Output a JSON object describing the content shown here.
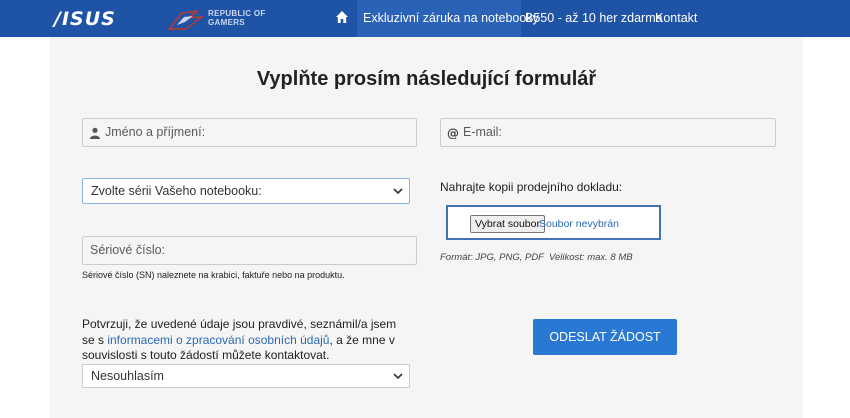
{
  "nav": {
    "asus_logo": "/ISUS",
    "rog_logo_line1": "REPUBLIC OF",
    "rog_logo_line2": "GAMERS",
    "home_icon": "home-icon",
    "items": [
      {
        "label": "Exkluzivní záruka na notebooky",
        "active": true
      },
      {
        "label": "B550 - až 10 her zdarma",
        "active": false
      },
      {
        "label": "Kontakt",
        "active": false
      }
    ],
    "bar_color": "#1f53a6"
  },
  "form": {
    "title": "Vyplňte prosím následující formulář",
    "name_placeholder": "Jméno a příjmení:",
    "email_placeholder": "E-mail:",
    "series_select_value": "Zvolte sérii Vašeho notebooku:",
    "upload_label": "Nahrajte kopii prodejního dokladu:",
    "upload_button": "Vybrat soubor",
    "upload_status": "Soubor nevybrán",
    "upload_format": "Formát: JPG, PNG, PDF",
    "upload_size": "Velikost: max. 8 MB",
    "serial_placeholder": "Sériové číslo:",
    "serial_hint": "Sériové číslo (SN) naleznete na krabici, faktuře nebo na produktu.",
    "consent_text_before": "Potvrzuji, že uvedené údaje jsou pravdivé, seznámil/a jsem se s ",
    "consent_link": "informacemi o zpracování osobních údajů",
    "consent_text_after": ", a že mne v souvislosti s touto žádostí můžete kontaktovat.",
    "consent_select_value": "Nesouhlasím",
    "submit_label": "ODESLAT ŽÁDOST",
    "accent_color": "#2979d4"
  }
}
